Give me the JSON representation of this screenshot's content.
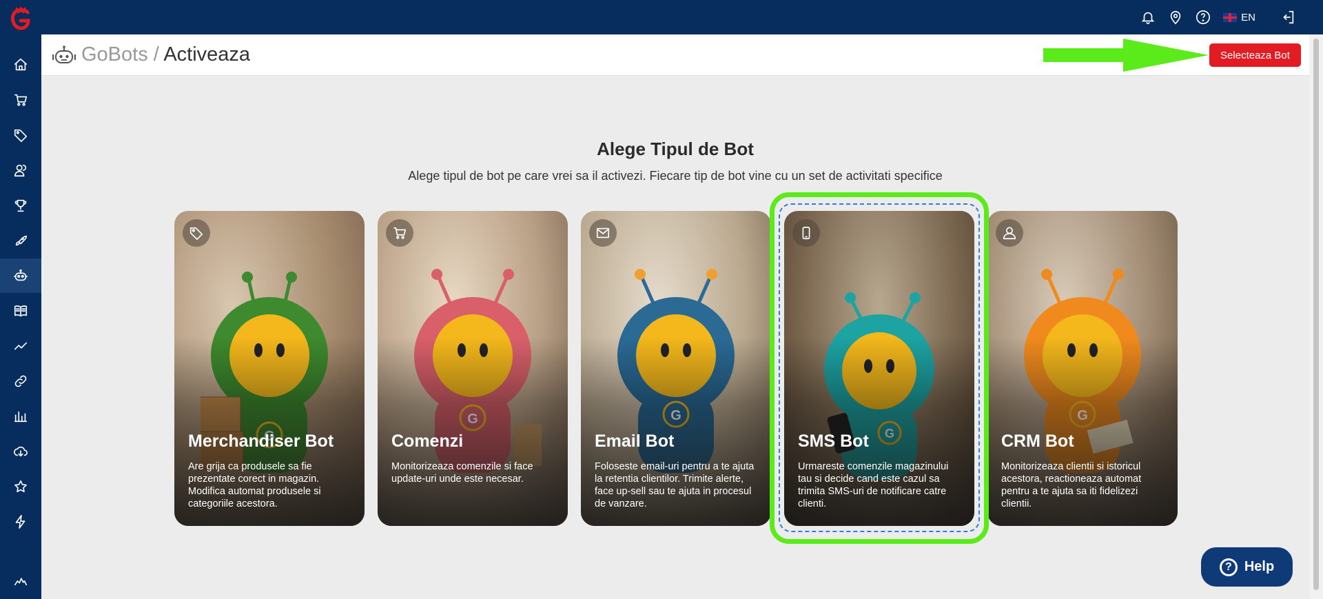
{
  "topbar": {
    "icons": [
      "bell-icon",
      "location-icon",
      "help-icon",
      "logout-icon"
    ],
    "language": "EN"
  },
  "sidebar": {
    "items": [
      {
        "icon": "home-icon"
      },
      {
        "icon": "cart-icon"
      },
      {
        "icon": "tag-icon"
      },
      {
        "icon": "users-icon"
      },
      {
        "icon": "trophy-icon"
      },
      {
        "icon": "rocket-icon"
      },
      {
        "icon": "robot-icon",
        "active": true
      },
      {
        "icon": "book-icon"
      },
      {
        "icon": "trend-icon"
      },
      {
        "icon": "link-icon"
      },
      {
        "icon": "bar-chart-icon"
      },
      {
        "icon": "cloud-download-icon"
      },
      {
        "icon": "star-icon"
      },
      {
        "icon": "bolt-icon"
      },
      {
        "icon": "activity-icon"
      }
    ]
  },
  "header": {
    "breadcrumb_root": "GoBots",
    "separator": "/",
    "breadcrumb_current": "Activeaza",
    "select_button": "Selecteaza Bot"
  },
  "main": {
    "title": "Alege Tipul de Bot",
    "subtitle": "Alege tipul de bot pe care vrei sa il activezi. Fiecare tip de bot vine cu un set de activitati specifice"
  },
  "cards": [
    {
      "title": "Merchandiser Bot",
      "desc": "Are grija ca produsele sa fie prezentate corect in magazin. Modifica automat produsele si categoriile acestora.",
      "icon": "tag-icon",
      "suit_color": "#3e8a2e"
    },
    {
      "title": "Comenzi",
      "desc": "Monitorizeaza comenzile si face update-uri unde este necesar.",
      "icon": "cart-icon",
      "suit_color": "#d9606a"
    },
    {
      "title": "Email Bot",
      "desc": "Foloseste email-uri pentru a te ajuta la retentia clientilor. Trimite alerte, face up-sell sau te ajuta in procesul de vanzare.",
      "icon": "mail-icon",
      "suit_color": "#2a6a95"
    },
    {
      "title": "SMS Bot",
      "desc": "Urmareste comenzile magazinului tau si decide cand este cazul sa trimita SMS-uri de notificare catre clienti.",
      "icon": "phone-icon",
      "suit_color": "#1ea3a3",
      "selected": true
    },
    {
      "title": "CRM Bot",
      "desc": "Monitorizeaza clientii si istoricul acestora, reactioneaza automat pentru a te ajuta sa iti fidelizezi clientii.",
      "icon": "user-icon",
      "suit_color": "#f08a1e"
    }
  ],
  "help": {
    "label": "Help"
  },
  "colors": {
    "navy": "#072d5e",
    "accent_red": "#e31b23",
    "highlight_green": "#5bea1a",
    "dash_blue": "#2c7fd6"
  }
}
